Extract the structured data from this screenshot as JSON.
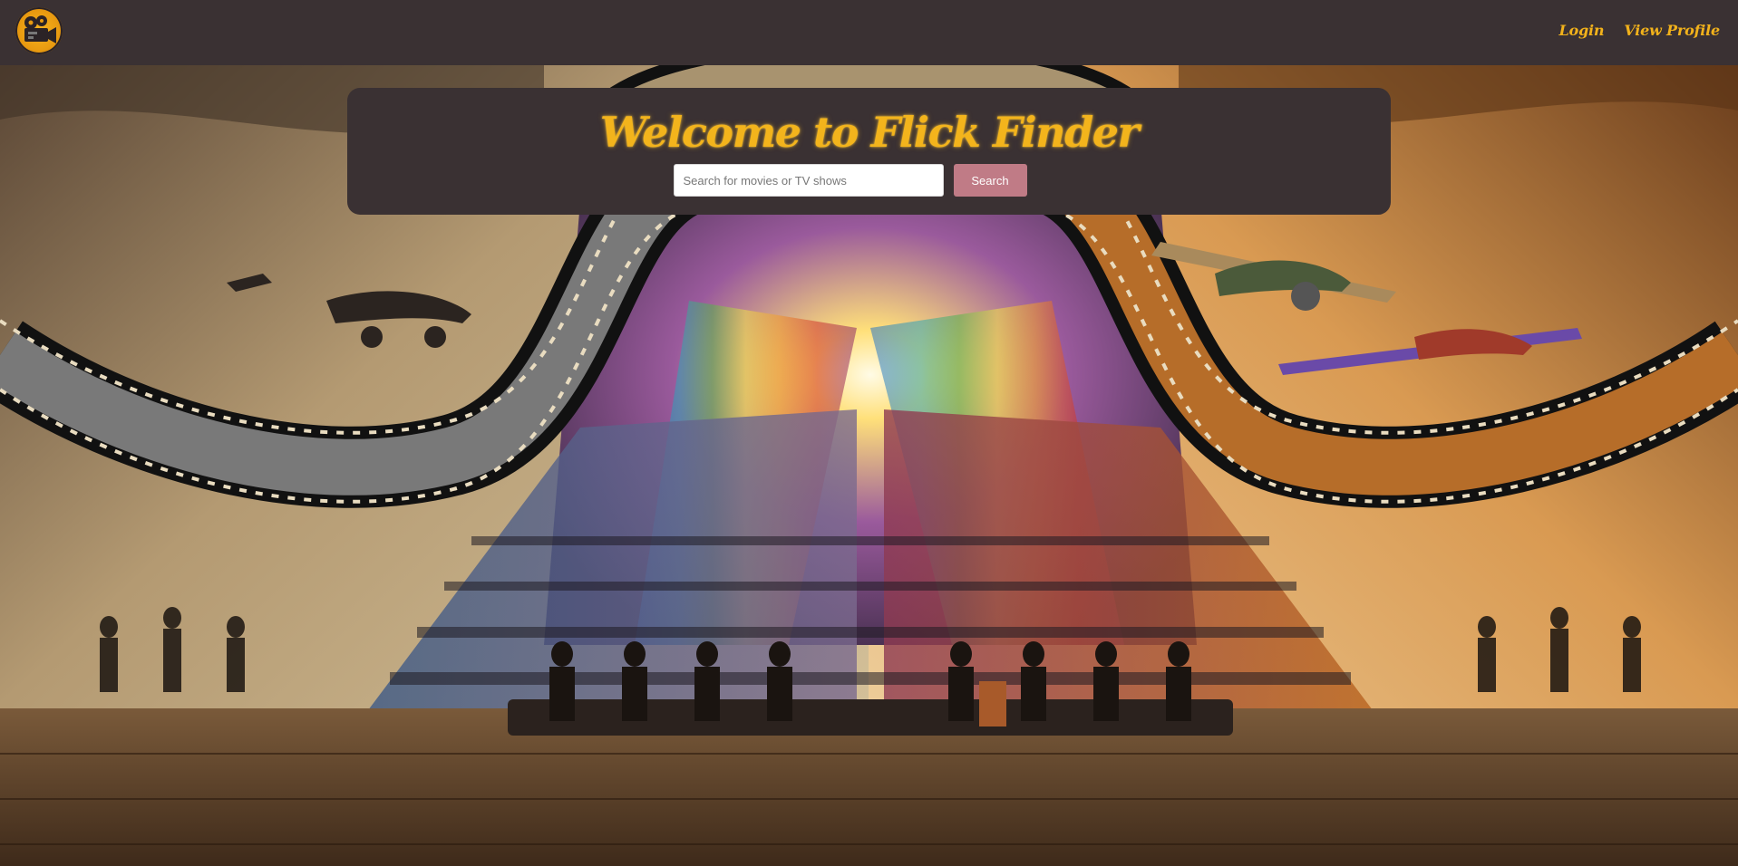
{
  "navbar": {
    "logo": "film-camera-logo-icon",
    "links": {
      "login": "Login",
      "view_profile": "View Profile"
    }
  },
  "hero": {
    "title": "Welcome to Flick Finder",
    "search": {
      "placeholder": "Search for movies or TV shows",
      "value": "",
      "button_label": "Search"
    },
    "background": "cinema-filmstrip-audience-artwork"
  },
  "colors": {
    "navbar_bg": "#3a3133",
    "accent_gold": "#f3b41c",
    "search_button_bg": "#c07b86"
  }
}
